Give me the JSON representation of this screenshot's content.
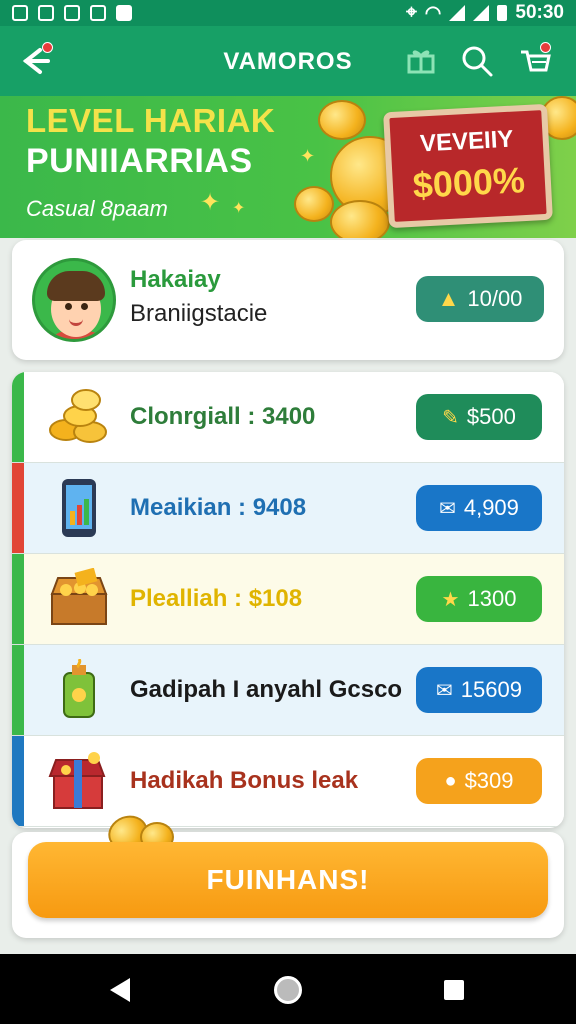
{
  "status_bar": {
    "time": "50:30"
  },
  "app_bar": {
    "title": "VAMOROS"
  },
  "banner": {
    "title": "LEVEL HARIAK",
    "subtitle": "PUNIIARRIAS",
    "tagline": "Casual 8paam",
    "sign_top": "VEVEIIY",
    "sign_amount": "$000%"
  },
  "profile": {
    "name": "Hakaiay",
    "subtitle": "Braniigstacie",
    "points": "10/00"
  },
  "rewards": [
    {
      "label": "Clonrgiall : 3400",
      "button": "$500",
      "icon": "coins-icon",
      "color": "#2e7d3a",
      "accent": "#3bb84a",
      "bg": "#ffffff",
      "btn": "#1f8c5a"
    },
    {
      "label": "Meaikian : 9408",
      "button": "4,909",
      "icon": "tablet-icon",
      "color": "#1f6fb2",
      "accent": "#e14536",
      "bg": "#e8f4fb",
      "btn": "#1976c8"
    },
    {
      "label": "Plealliah : $108",
      "button": "1300",
      "icon": "treasure-icon",
      "color": "#e0b400",
      "accent": "#3bb84a",
      "bg": "#fdfbe8",
      "btn": "#39b53f"
    },
    {
      "label": "Gadipah I anyahl Gcsco",
      "button": "15609",
      "icon": "potion-icon",
      "color": "#1a1a1a",
      "accent": "#3bb84a",
      "bg": "#e8f4fb",
      "btn": "#1976c8"
    },
    {
      "label": "Hadikah Bonus leak",
      "button": "$309",
      "icon": "gift-box-icon",
      "color": "#a8321d",
      "accent": "#1f78c0",
      "bg": "#ffffff",
      "btn": "#f5a21c"
    }
  ],
  "action": {
    "label": "FUINHANS!"
  }
}
